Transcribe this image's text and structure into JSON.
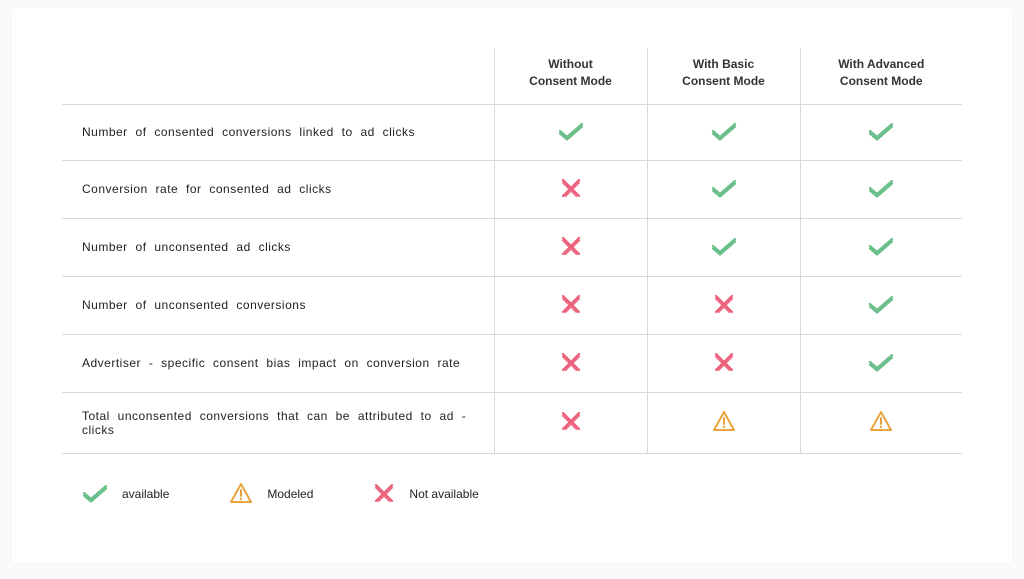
{
  "columns": [
    {
      "line1": "Without",
      "line2": "Consent  Mode"
    },
    {
      "line1": "With Basic",
      "line2": "Consent  Mode"
    },
    {
      "line1": "With Advanced",
      "line2": "Consent  Mode"
    }
  ],
  "rows": [
    {
      "label": "Number  of consented   conversions   linked  to ad  clicks",
      "cells": [
        "check",
        "check",
        "check"
      ]
    },
    {
      "label": "Conversion   rate for consented   ad clicks",
      "cells": [
        "cross",
        "check",
        "check"
      ]
    },
    {
      "label": "Number  of unconsented    ad clicks",
      "cells": [
        "cross",
        "check",
        "check"
      ]
    },
    {
      "label": "Number  of unconsented    conversions",
      "cells": [
        "cross",
        "cross",
        "check"
      ]
    },
    {
      "label": "Advertiser  - specific  consent  bias impact  on conversion   rate",
      "cells": [
        "cross",
        "cross",
        "check"
      ]
    },
    {
      "label": "Total  unconsented   conversions   that  can be attributed   to ad - clicks",
      "cells": [
        "cross",
        "warn",
        "warn"
      ]
    }
  ],
  "legend": {
    "available": "available",
    "modeled": "Modeled",
    "not_available": "Not available"
  },
  "icons": {
    "check": "check-icon",
    "cross": "cross-icon",
    "warn": "warning-icon"
  },
  "colors": {
    "check": "#6bbf8a",
    "cross": "#ec5f7a",
    "warn": "#e8a33d"
  }
}
